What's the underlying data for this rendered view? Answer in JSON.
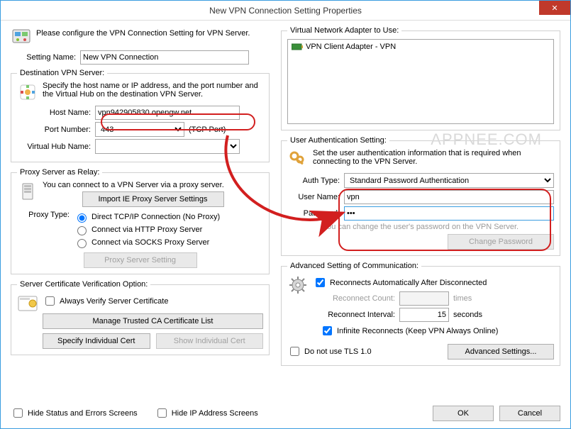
{
  "window": {
    "title": "New VPN Connection Setting Properties",
    "close": "✕"
  },
  "intro": {
    "text": "Please configure the VPN Connection Setting for VPN Server.",
    "settingNameLabel": "Setting Name:",
    "settingNameValue": "New VPN Connection"
  },
  "dest": {
    "legend": "Destination VPN Server:",
    "help": "Specify the host name or IP address, and the port number and the Virtual Hub on the destination VPN Server.",
    "hostLabel": "Host Name:",
    "hostValue": "vpn942905830.opengw.net",
    "portLabel": "Port Number:",
    "portValue": "443",
    "portHint": "(TCP Port)",
    "hubLabel": "Virtual Hub Name:",
    "hubValue": ""
  },
  "proxy": {
    "legend": "Proxy Server as Relay:",
    "help": "You can connect to a VPN Server via a proxy server.",
    "importBtn": "Import IE Proxy Server Settings",
    "typeLabel": "Proxy Type:",
    "opt1": "Direct TCP/IP Connection (No Proxy)",
    "opt2": "Connect via HTTP Proxy Server",
    "opt3": "Connect via SOCKS Proxy Server",
    "settingBtn": "Proxy Server Setting"
  },
  "cert": {
    "legend": "Server Certificate Verification Option:",
    "alwaysVerify": "Always Verify Server Certificate",
    "manageBtn": "Manage Trusted CA Certificate List",
    "specifyBtn": "Specify Individual Cert",
    "showBtn": "Show Individual Cert"
  },
  "adapter": {
    "legend": "Virtual Network Adapter to Use:",
    "item": "VPN Client Adapter - VPN"
  },
  "auth": {
    "legend": "User Authentication Setting:",
    "help": "Set the user authentication information that is required when connecting to the VPN Server.",
    "typeLabel": "Auth Type:",
    "typeValue": "Standard Password Authentication",
    "userLabel": "User Name:",
    "userValue": "vpn",
    "passLabel": "Password:",
    "passValue": "•••",
    "note": "You can change the user's password on the VPN Server.",
    "changeBtn": "Change Password"
  },
  "adv": {
    "legend": "Advanced Setting of Communication:",
    "reconn": "Reconnects Automatically After Disconnected",
    "countLabel": "Reconnect Count:",
    "countUnit": "times",
    "intervalLabel": "Reconnect Interval:",
    "intervalValue": "15",
    "intervalUnit": "seconds",
    "infinite": "Infinite Reconnects (Keep VPN Always Online)",
    "noTls": "Do not use TLS 1.0",
    "advBtn": "Advanced Settings..."
  },
  "footer": {
    "hideStatus": "Hide Status and Errors Screens",
    "hideIp": "Hide IP Address Screens",
    "ok": "OK",
    "cancel": "Cancel"
  },
  "watermark": "APPNEE.COM"
}
